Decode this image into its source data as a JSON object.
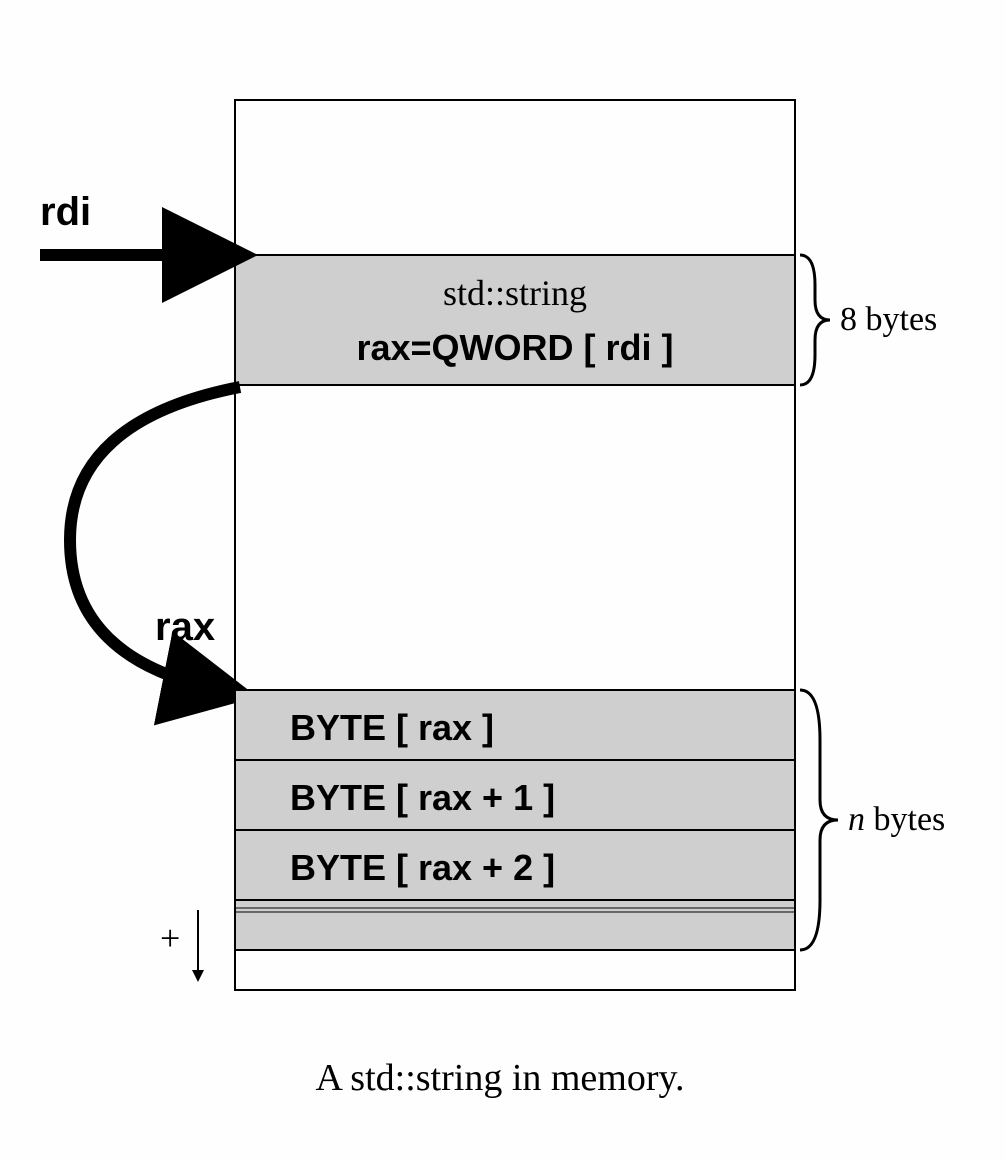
{
  "registers": {
    "rdi": "rdi",
    "rax": "rax"
  },
  "memory_box": {
    "top_cell": {
      "label": "std::string",
      "content": "rax=QWORD [ rdi ]",
      "size": "8 bytes"
    },
    "bytes": [
      "BYTE [ rax ]",
      "BYTE [ rax + 1 ]",
      "BYTE [ rax + 2 ]"
    ],
    "bytes_size": "n bytes",
    "plus": "+"
  },
  "caption": "A std::string in memory."
}
